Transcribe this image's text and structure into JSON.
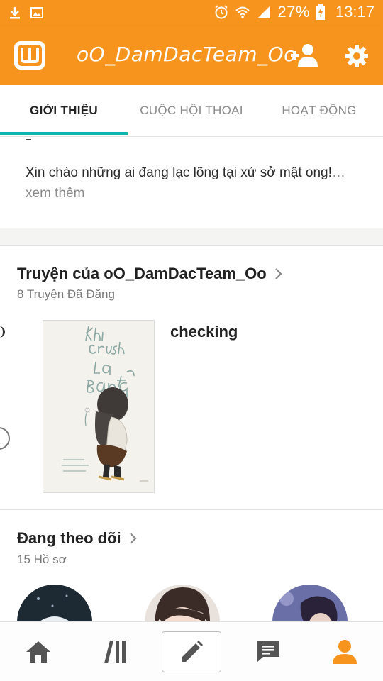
{
  "status_bar": {
    "battery_percent": "27%",
    "time": "13:17"
  },
  "app_bar": {
    "title": "oO_DamDacTeam_Oo",
    "logo_icon": "wattpad-logo",
    "add_user_icon": "add-user-icon",
    "settings_icon": "gear-icon",
    "color": "#f7941d"
  },
  "tabs": [
    {
      "label": "GIỚI THIỆU",
      "active": true
    },
    {
      "label": "CUỘC HỘI THOẠI",
      "active": false
    },
    {
      "label": "HOẠT ĐỘNG",
      "active": false
    }
  ],
  "accent_color": "#12b5b0",
  "about": {
    "text": "Xin chào những ai đang lạc lõng tại xứ sở mật ong!",
    "more_label": "… xem thêm"
  },
  "stories": {
    "title": "Truyện của oO_DamDacTeam_Oo",
    "subtitle": "8 Truyện Đã Đăng",
    "items": [
      {
        "title": "checking",
        "cover_text": "Khi crush là Bang chủ tan?"
      }
    ]
  },
  "following": {
    "title": "Đang theo dõi",
    "subtitle": "15 Hồ sơ"
  },
  "bottom_nav": [
    {
      "name": "home-icon"
    },
    {
      "name": "library-icon"
    },
    {
      "name": "write-icon"
    },
    {
      "name": "messages-icon"
    },
    {
      "name": "profile-icon",
      "active": true
    }
  ]
}
